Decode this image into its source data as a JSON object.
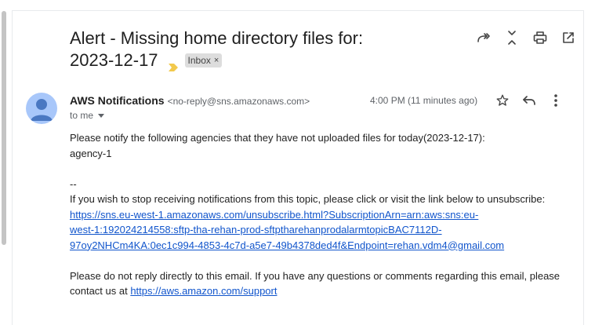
{
  "email": {
    "subject_line1": "Alert - Missing home directory files for:",
    "subject_line2": "2023-12-17",
    "label_chip": "Inbox",
    "label_chip_close": "×",
    "sender_name": "AWS Notifications",
    "sender_email": "<no-reply@sns.amazonaws.com>",
    "time": "4:00 PM (11 minutes ago)",
    "to_text": "to me",
    "body": {
      "line1": "Please notify the following agencies that they have not uploaded files for today(2023-12-17):",
      "line2": "agency-1",
      "separator": "--",
      "unsubscribe_text": "If you wish to stop receiving notifications from this topic, please click or visit the link below to unsubscribe:",
      "unsubscribe_link_1": "https://sns.eu-west-1.amazonaws.com/unsubscribe.html?SubscriptionArn=arn:aws:sns:eu-",
      "unsubscribe_link_2": "west-1:192024214558:sftp-tha-rehan-prod-sftptharehanprodalarmtopicBAC7112D-",
      "unsubscribe_link_3": "97oy2NHCm4KA:0ec1c994-4853-4c7d-a5e7-49b4378ded4f&Endpoint=rehan.vdm4@gmail.com",
      "footer_text_1": "Please do not reply directly to this email. If you have any questions or comments regarding this email, please",
      "footer_text_2": "contact us at ",
      "support_link": "https://aws.amazon.com/support"
    }
  },
  "icons": {
    "forward_all": "forward-all-icon",
    "collapse": "collapse-all-icon",
    "print": "print-icon",
    "open_new_window": "open-in-new-window-icon",
    "star": "star-icon",
    "reply": "reply-icon",
    "more": "more-vert-icon",
    "avatar": "avatar-icon",
    "important_marker": "importance-marker-icon"
  },
  "colors": {
    "link": "#1155cc",
    "avatar_bg": "#a8c7fa",
    "avatar_fg": "#4a78c2",
    "important_marker": "#f2c94c",
    "chip_bg": "#dddddd"
  }
}
